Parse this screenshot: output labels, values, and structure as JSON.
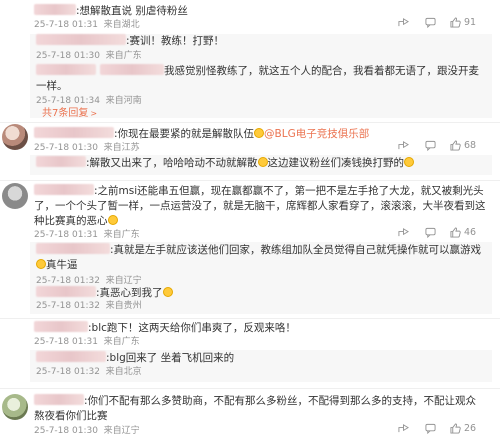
{
  "comments": [
    {
      "text": ":想解散直说 别虐待粉丝",
      "time": "25-7-18 01:31",
      "location": "来自湖北",
      "likes": "91",
      "replies": [
        {
          "text": ":赛训！教练！打野！",
          "time": "25-7-18 01:30",
          "location": "来自广东"
        },
        {
          "text": "我感觉别怪教练了，就这五个人的配合，我看着都无语了，跟没开麦一样。",
          "time": "25-7-18 01:34",
          "location": "来自河南"
        }
      ],
      "expand": "共7条回复"
    },
    {
      "text": ":你现在最要紧的就是解散队伍",
      "mention": "@BLG电子竞技俱乐部",
      "time": "25-7-18 01:30",
      "location": "来自江苏",
      "likes": "68",
      "replies": [
        {
          "text": ":解散又出来了，哈哈哈动不动就解散",
          "text2": "这边建议粉丝们凑钱换打野的",
          "time": "",
          "location": ""
        }
      ]
    },
    {
      "text": ":之前msi还能串五但赢，现在赢都赢不了，第一把不是左手抢了大龙，就又被剩光头了，一个个头了暂一样，一点运营没了，就是无脑干，席辉都人家看穿了，滚滚滚，大半夜看到这种比赛真的恶心",
      "time": "25-7-18 01:31",
      "location": "来自广东",
      "likes": "46",
      "replies": [
        {
          "text": ":真就是左手就应该送他们回家，教练组加队全员觉得自己就凭操作就可以赢游戏",
          "text2": "真牛逼",
          "time": "25-7-18 01:32",
          "location": "来自辽宁"
        },
        {
          "text": ":真恶心到我了",
          "time": "25-7-18 01:32",
          "location": "来自贵州"
        }
      ]
    },
    {
      "text": ":blc跑下！这两天给你们串爽了，反观来咯！",
      "time": "25-7-18 01:31",
      "location": "来自广东",
      "likes": "",
      "replies": [
        {
          "text": ":blg回来了 坐着飞机回来的",
          "time": "25-7-18 01:32",
          "location": "来自北京"
        }
      ]
    },
    {
      "text": ":你们不配有那么多赞助商，不配有那么多粉丝，不配得到那么多的支持，不配让观众熬夜看你们比赛",
      "time": "25-7-18 01:30",
      "location": "来自辽宁",
      "likes": "26"
    }
  ],
  "icons": {
    "share": "share-icon",
    "comment": "comment-icon",
    "like": "thumbs-up-icon"
  },
  "colors": {
    "link": "#eb7350",
    "meta": "#939393",
    "reply_bg": "#f7f7f7"
  }
}
